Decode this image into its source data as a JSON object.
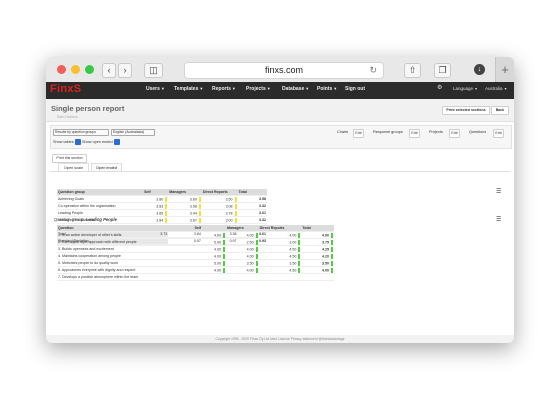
{
  "browser": {
    "url": "finxs.com"
  },
  "nav": {
    "logo": "FinxS",
    "items": [
      "Users",
      "Templates",
      "Reports",
      "Projects",
      "Database",
      "Points",
      "Sign out"
    ],
    "right": [
      "Language",
      "Australia"
    ]
  },
  "page": {
    "title": "Single person report",
    "subtitle": "Sam Hobson",
    "print_btn": "Print selected sections",
    "back_btn": "Back"
  },
  "filters": {
    "results_by": "Results by question groups",
    "language": "English (Australasia)",
    "show_tables": "Show tables",
    "show_open": "Show open ended",
    "charts": "Charts",
    "response_groups": "Response groups",
    "projects": "Projects",
    "questions": "Questions",
    "edit": "Edit"
  },
  "print_section": "Print this section",
  "tabs": [
    "Open scale",
    "Open ended"
  ],
  "group_table": {
    "headers": [
      "Question group",
      "Self",
      "Managers",
      "Direct Reports",
      "Total"
    ],
    "rows": [
      [
        "Achieving Goals",
        "3.80",
        "3.60",
        "3.50",
        "3.58"
      ],
      [
        "Co-operation within the organisation",
        "3.83",
        "3.58",
        "3.08",
        "3.32"
      ],
      [
        "Leading People",
        "3.85",
        "3.44",
        "3.78",
        "3.61"
      ],
      [
        "Managing the Business",
        "3.84",
        "3.67",
        "3.00",
        "3.32"
      ],
      [
        "Self-Development",
        "4.38",
        "3.88",
        "3.50",
        "3.69"
      ]
    ],
    "total": [
      "Total",
      "3.73",
      "3.84",
      "3.38",
      "3.61"
    ],
    "std": [
      "Standard Deviation",
      "",
      "0.97",
      "0.97",
      "0.93"
    ]
  },
  "qgroup": {
    "label": "Question Group:",
    "name": "Leading People"
  },
  "q_table": {
    "headers": [
      "Question",
      "Self",
      "Managers",
      "Direct Reports",
      "Total"
    ],
    "rows": [
      [
        "1. Is an active developer of other's skills",
        "4.00",
        "4.00",
        "4.00",
        "4.00"
      ],
      [
        "2. Can adjust style approach with different people",
        "5.00",
        "2.50",
        "3.00",
        "3.75"
      ],
      [
        "3. Builds openness and excitement",
        "4.00",
        "4.00",
        "4.50",
        "4.25"
      ],
      [
        "4. Maintains cooperation among people",
        "4.00",
        "4.00",
        "4.50",
        "4.20"
      ],
      [
        "5. Motivates people to do quality work",
        "5.00",
        "3.50",
        "3.50",
        "3.50"
      ],
      [
        "6. Approaches everyone with dignity and respect",
        "4.00",
        "4.00",
        "4.50",
        "4.00"
      ],
      [
        "7. Develops a positive atmosphere within the team",
        "",
        "",
        "",
        ""
      ]
    ]
  },
  "footer": "Copyright 1995 - 2020 Finxs Oy Ltd   User License   Privacy statement   @finxsbackstage"
}
